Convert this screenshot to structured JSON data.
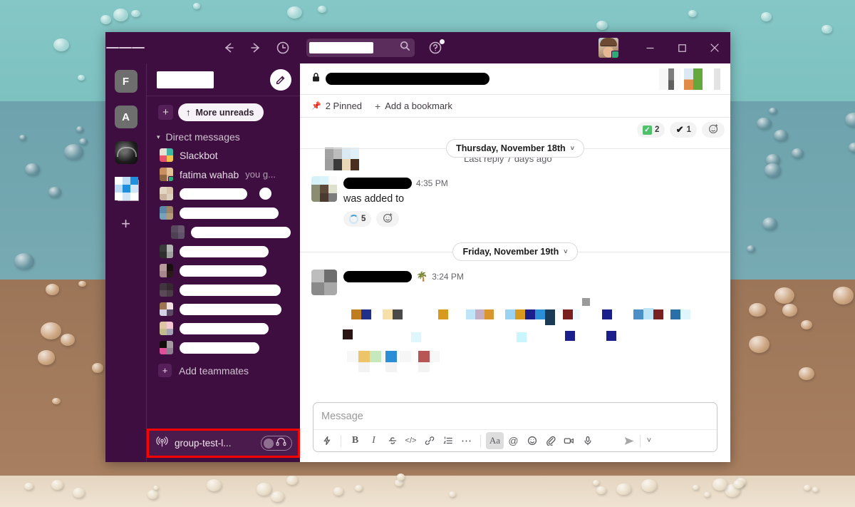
{
  "desktop": {
    "wallpaper_bands": [
      "#84c7c6",
      "#6ea3ad",
      "#9c7558",
      "#e9dcc6"
    ]
  },
  "titlebar": {
    "hamburger_name": "menu-icon",
    "back_label": "Back",
    "forward_label": "Forward",
    "history_label": "History",
    "search": {
      "value": "",
      "placeholder": "Search",
      "redacted": true
    },
    "help_label": "Help",
    "help_has_notification": true,
    "window_controls": {
      "minimize": "—",
      "maximize": "☐",
      "close": "✕"
    }
  },
  "rail": {
    "workspaces": [
      {
        "label": "F",
        "type": "letter"
      },
      {
        "label": "A",
        "type": "letter"
      },
      {
        "label": "",
        "type": "image"
      },
      {
        "label": "",
        "type": "grid"
      }
    ],
    "add_label": "+"
  },
  "sidebar": {
    "workspace_name": "",
    "workspace_name_redacted": true,
    "compose_icon": "compose-icon",
    "unreads": {
      "plus_label": "+",
      "pill_label": "More unreads",
      "arrow": "↑"
    },
    "dm_section": {
      "label": "Direct messages",
      "caret": "▾"
    },
    "dms": [
      {
        "name": "Slackbot",
        "extra": "",
        "redacted": false,
        "avatar": [
          "#e8e0d4",
          "#3fb5a2",
          "#e8536d",
          "#f2c14e"
        ],
        "trailing_dot": false
      },
      {
        "name": "fatima wahab",
        "extra": "you  g...",
        "redacted": false,
        "avatar": [
          "#c98f5e",
          "#e3c49a",
          "#8e6340",
          "#d9b48f"
        ],
        "badge": true,
        "trailing_dot": false
      },
      {
        "name": "",
        "extra": "",
        "redacted": true,
        "redact_width": 95,
        "avatar": [
          "#e3d5c4",
          "#d9c4ad",
          "#c9b39c",
          "#ddd0c0"
        ],
        "trailing_dot": true
      },
      {
        "name": "",
        "extra": "",
        "redacted": true,
        "redact_width": 139,
        "avatar": [
          "#5b87a8",
          "#9d8468",
          "#77a0bb",
          "#b49a7c"
        ],
        "trailing_dot": false
      },
      {
        "name": "",
        "extra": "",
        "redacted": true,
        "redact_width": 140,
        "indent": true,
        "avatar": [
          "#5a4a5e",
          "#6b5a6f",
          "#4f4054",
          "#625269"
        ],
        "trailing_dot": false
      },
      {
        "name": "",
        "extra": "",
        "redacted": true,
        "redact_width": 125,
        "avatar": [
          "#3a3a3a",
          "#b5b5b5",
          "#2e2e2e",
          "#a0a0a0"
        ],
        "trailing_dot": false
      },
      {
        "name": "",
        "extra": "",
        "redacted": true,
        "redact_width": 122,
        "avatar": [
          "#bb9a9e",
          "#190f0f",
          "#a8888c",
          "#2a1a1a"
        ],
        "trailing_dot": false
      },
      {
        "name": "",
        "extra": "",
        "redacted": true,
        "redact_width": 142,
        "avatar": [
          "#413640",
          "#35292f",
          "#5a4a58",
          "#4b3c48"
        ],
        "trailing_dot": false
      },
      {
        "name": "",
        "extra": "",
        "redacted": true,
        "redact_width": 143,
        "avatar": [
          "#9c7452",
          "#f2e0e3",
          "#d2d2e4",
          "#5b4a63"
        ],
        "trailing_dot": false
      },
      {
        "name": "",
        "extra": "",
        "redacted": true,
        "redact_width": 125,
        "avatar": [
          "#e0c3a5",
          "#f3c8d4",
          "#c3bd8c",
          "#a9a3b6"
        ],
        "trailing_dot": false
      },
      {
        "name": "",
        "extra": "",
        "redacted": true,
        "redact_width": 112,
        "avatar": [
          "#140d0d",
          "#a79aa2",
          "#e0509a",
          "#8e7f93"
        ],
        "trailing_dot": false
      }
    ],
    "add_teammates": {
      "label": "Add teammates",
      "plus": "+"
    },
    "huddle": {
      "name": "group-test-l...",
      "broadcast_icon": "broadcast-icon",
      "headset_icon": "headset-icon",
      "highlight_color": "#ff0000",
      "toggle_on": false
    }
  },
  "channel": {
    "lock_icon": "lock-icon",
    "name": "",
    "name_redacted": true,
    "bookmarks": {
      "pinned_label": "2 Pinned",
      "pin_icon": "pin-icon",
      "add_label": "Add a bookmark",
      "plus": "+"
    }
  },
  "messages": {
    "thread_reactions": [
      {
        "type": "green-check",
        "count": "2"
      },
      {
        "type": "check",
        "count": "1"
      },
      {
        "type": "add-reaction",
        "count": ""
      }
    ],
    "divider_1": {
      "label": "Thursday, November 18th",
      "caret": "˅"
    },
    "last_reply": "Last reply 7 days ago",
    "items": [
      {
        "name": "",
        "name_redacted": true,
        "time": "4:35 PM",
        "emoji": "",
        "text": "was added to",
        "reactions": [
          {
            "type": "spinner",
            "count": "5"
          },
          {
            "type": "add-reaction",
            "count": ""
          }
        ],
        "avatar": [
          "#d6f2f8",
          "#5e4a3b",
          "#dde0cd",
          "#8b8d72",
          "#4a3a30",
          "#7d7d7d"
        ]
      }
    ],
    "divider_2": {
      "label": "Friday, November 19th",
      "caret": "˅"
    },
    "item_2": {
      "name": "",
      "name_redacted": true,
      "time": "3:24 PM",
      "emoji": "🌴",
      "avatar": [
        "#bdbdbd",
        "#6e6e6e",
        "#8a8a8a",
        "#a8a8a8"
      ]
    },
    "redacted_blocks_note": "pixelated message content"
  },
  "composer": {
    "placeholder": "Message",
    "tools": [
      {
        "name": "shortcuts-icon",
        "label": ""
      },
      {
        "name": "bold-button",
        "label": "B"
      },
      {
        "name": "italic-button",
        "label": "I"
      },
      {
        "name": "strikethrough-button",
        "label": "S"
      },
      {
        "name": "code-button",
        "label": "</>"
      },
      {
        "name": "link-button",
        "label": ""
      },
      {
        "name": "ordered-list-button",
        "label": ""
      },
      {
        "name": "more-formatting-button",
        "label": "⋯"
      },
      {
        "name": "formatting-toggle-button",
        "label": "Aa",
        "active": true
      },
      {
        "name": "mention-button",
        "label": "@"
      },
      {
        "name": "emoji-button",
        "label": ""
      },
      {
        "name": "attachment-button",
        "label": ""
      },
      {
        "name": "video-clip-button",
        "label": ""
      },
      {
        "name": "audio-clip-button",
        "label": ""
      },
      {
        "name": "send-button",
        "label": ""
      },
      {
        "name": "send-options-button",
        "label": "˅"
      }
    ]
  }
}
